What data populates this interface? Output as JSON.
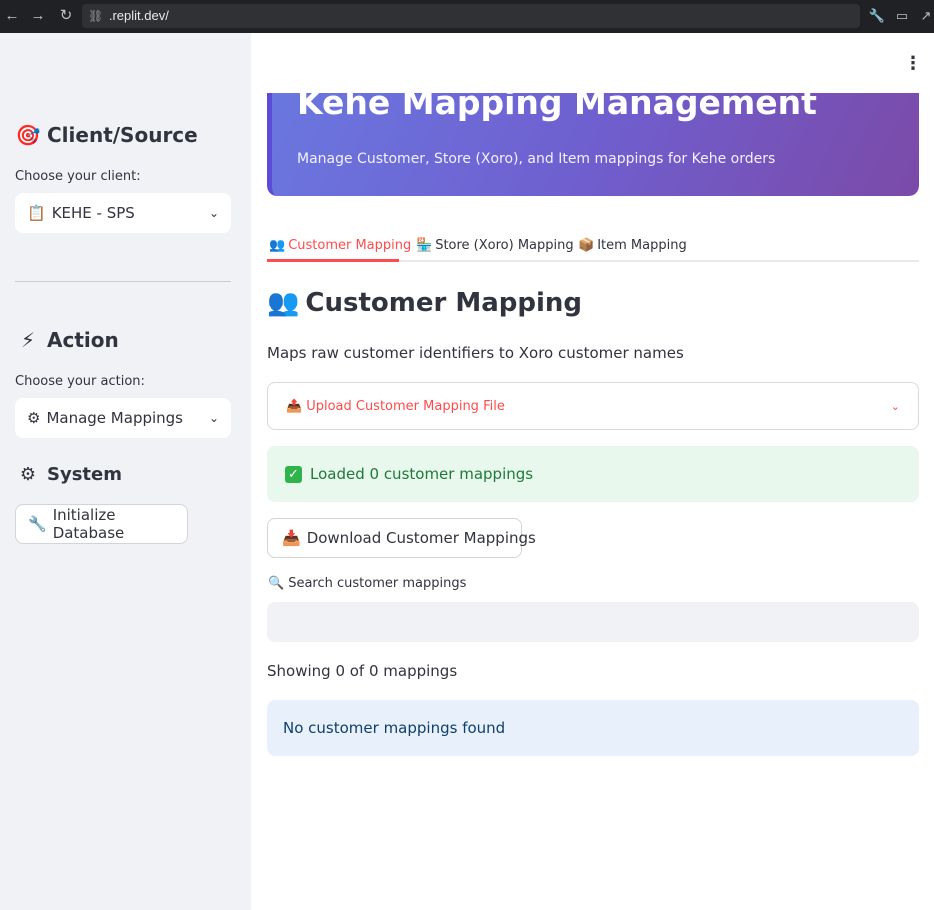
{
  "browser": {
    "url": ".replit.dev/",
    "back_icon": "←",
    "forward_icon": "→",
    "reload_icon": "↻"
  },
  "sidebar": {
    "client_section": {
      "icon": "🎯",
      "title": "Client/Source",
      "label": "Choose your client:",
      "select_icon": "📋",
      "selected": "KEHE - SPS"
    },
    "action_section": {
      "icon": "⚡",
      "title": "Action",
      "label": "Choose your action:",
      "select_icon": "⚙",
      "selected": "Manage Mappings"
    },
    "system_section": {
      "icon": "⚙",
      "title": "System",
      "button_icon": "🔧",
      "button_label": "Initialize Database"
    }
  },
  "main": {
    "menu_icon": "⋮",
    "banner": {
      "title": "Kehe Mapping Management",
      "subtitle": "Manage Customer, Store (Xoro), and Item mappings for Kehe orders"
    },
    "tabs": [
      {
        "icon": "👥",
        "label": "Customer Mapping",
        "active": true
      },
      {
        "icon": "🏪",
        "label": "Store (Xoro) Mapping",
        "active": false
      },
      {
        "icon": "📦",
        "label": "Item Mapping",
        "active": false
      }
    ],
    "section": {
      "icon": "👥",
      "title": "Customer Mapping",
      "description": "Maps raw customer identifiers to Xoro customer names"
    },
    "expander": {
      "icon": "📤",
      "label": "Upload Customer Mapping File"
    },
    "success": {
      "icon": "✓",
      "text": "Loaded 0 customer mappings"
    },
    "download_button": {
      "icon": "📥",
      "label": "Download Customer Mappings"
    },
    "search": {
      "icon": "🔍",
      "label": "Search customer mappings",
      "value": "",
      "placeholder": ""
    },
    "showing_text": "Showing 0 of 0 mappings",
    "info_text": "No customer mappings found"
  },
  "colors": {
    "accent": "#ff4b4b",
    "sidebar_bg": "#f0f2f6",
    "banner_start": "#6a78e0",
    "banner_end": "#7b4aa8",
    "success_bg": "#e8f8ec",
    "info_bg": "#e8f1fb"
  }
}
